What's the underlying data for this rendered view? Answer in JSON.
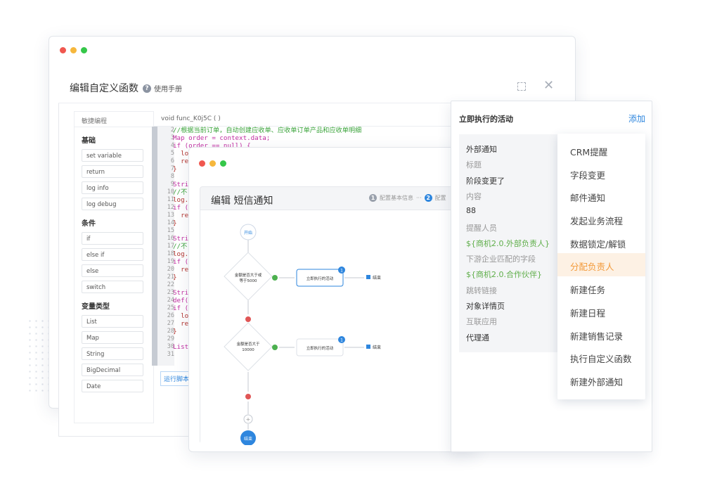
{
  "editor_window": {
    "title": "编辑自定义函数",
    "help_label": "使用手册",
    "func_signature": "void func_K0j5C ( )",
    "run_label": "运行脚本",
    "panel_title": "敏捷编程",
    "sections": [
      {
        "name": "基础",
        "items": [
          "set variable",
          "return",
          "log info",
          "log debug"
        ]
      },
      {
        "name": "条件",
        "items": [
          "if",
          "else if",
          "else",
          "switch"
        ]
      },
      {
        "name": "变量类型",
        "items": [
          "List",
          "Map",
          "String",
          "BigDecimal",
          "Date"
        ]
      }
    ],
    "line_numbers": [
      "2",
      "3",
      "4",
      "5",
      "6",
      "7",
      "8",
      "9",
      "10",
      "11",
      "12",
      "13",
      "14",
      "15",
      "16",
      "17",
      "18",
      "19",
      "20",
      "21",
      "22",
      "23",
      "24",
      "25",
      "26",
      "27",
      "28",
      "29",
      "30",
      "31"
    ],
    "code_lines": [
      "//根据当前订单，自动创建应收单、应收单订单产品和应收单明细",
      "Map order = context.data;",
      "if (order == null) {",
      "  lo",
      "  re",
      "}",
      "",
      "Stri",
      "//不",
      "log.",
      "if (",
      "  re",
      "}",
      "",
      "Stri",
      "//不",
      "log.",
      "if (",
      "  re",
      "}",
      "",
      "Stri",
      "def(",
      "if (",
      "  lo",
      "  re",
      "}",
      "",
      "List",
      ""
    ]
  },
  "sms_window": {
    "title": "编辑 短信通知",
    "step1": "配置基本信息",
    "step2": "配置",
    "flow": {
      "start": "开始",
      "cond1": "金额是否大于或等于5000",
      "act1": "立即执行的活动",
      "end1": "结束",
      "cond2": "金额是否大于10000",
      "act2": "立即执行的活动",
      "end2": "结束",
      "final": "结束",
      "badge1": "1",
      "badge2": "1",
      "plus": "+"
    }
  },
  "right_panel": {
    "title": "立即执行的活动",
    "add_label": "添加",
    "rows": [
      {
        "t": "外部通知",
        "c": "#333"
      },
      {
        "t": "标题",
        "c": "#999"
      },
      {
        "t": "阶段变更了",
        "c": "#333"
      },
      {
        "t": "内容",
        "c": "#999"
      },
      {
        "t": "88",
        "c": "#333"
      },
      {
        "t": "提醒人员",
        "c": "#999"
      },
      {
        "t": "${商机2.0.外部负责人}",
        "c": "#5fae4a"
      },
      {
        "t": "下游企业匹配的字段",
        "c": "#999"
      },
      {
        "t": "${商机2.0.合作伙伴}",
        "c": "#5fae4a"
      },
      {
        "t": "跳转链接",
        "c": "#999"
      },
      {
        "t": "对象详情页",
        "c": "#333"
      },
      {
        "t": "互联应用",
        "c": "#999"
      },
      {
        "t": "代理通",
        "c": "#333"
      }
    ],
    "menu": [
      "CRM提醒",
      "字段变更",
      "邮件通知",
      "发起业务流程",
      "数据锁定/解锁",
      "分配负责人",
      "新建任务",
      "新建日程",
      "新建销售记录",
      "执行自定义函数",
      "新建外部通知"
    ],
    "highlight_index": 5
  },
  "colors": {
    "accent": "#2e86de",
    "highlight": "#f39a3a",
    "green": "#5fae4a"
  }
}
